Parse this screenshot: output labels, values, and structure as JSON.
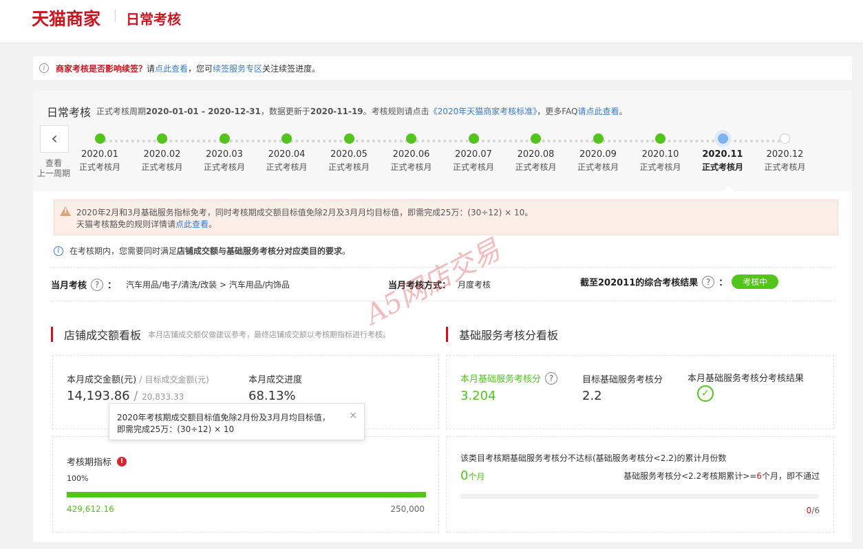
{
  "header": {
    "brand": "天猫商家",
    "title": "日常考核"
  },
  "notice": {
    "q": "商家考核是否影响续签？",
    "t1": "请",
    "link1": "点此查看",
    "t2": "，您可",
    "link2": "续签服务专区",
    "t3": "关注续签进度。"
  },
  "period": {
    "title": "日常考核",
    "d1": "正式考核周期",
    "range": "2020-01-01 - 2020-12-31",
    "d2": "，数据更新于",
    "updated": "2020-11-19",
    "d3": "。考核规则请点击",
    "rules_link": "《2020年天猫商家考核标准》",
    "d4": "，更多FAQ",
    "faq_link": "请点此查看",
    "d5": "。"
  },
  "prev": {
    "arrow": "‹",
    "line1": "查看",
    "line2": "上一周期"
  },
  "timeline": [
    {
      "date": "2020.01",
      "label": "正式考核月",
      "status": "done"
    },
    {
      "date": "2020.02",
      "label": "正式考核月",
      "status": "done"
    },
    {
      "date": "2020.03",
      "label": "正式考核月",
      "status": "done"
    },
    {
      "date": "2020.04",
      "label": "正式考核月",
      "status": "done"
    },
    {
      "date": "2020.05",
      "label": "正式考核月",
      "status": "done"
    },
    {
      "date": "2020.06",
      "label": "正式考核月",
      "status": "done"
    },
    {
      "date": "2020.07",
      "label": "正式考核月",
      "status": "done"
    },
    {
      "date": "2020.08",
      "label": "正式考核月",
      "status": "done"
    },
    {
      "date": "2020.09",
      "label": "正式考核月",
      "status": "done"
    },
    {
      "date": "2020.10",
      "label": "正式考核月",
      "status": "done"
    },
    {
      "date": "2020.11",
      "label": "正式考核月",
      "status": "current"
    },
    {
      "date": "2020.12",
      "label": "正式考核月",
      "status": "future"
    }
  ],
  "warning": {
    "line1": "2020年2月和3月基础服务指标免考，同时考核期成交额目标值免除2月及3月月均目标值，即需完成25万：(30÷12) × 10。",
    "line2_pre": "天猫考核豁免的规则详情请",
    "line2_link": "点此查看",
    "line2_post": "。"
  },
  "requirement": {
    "pre": "在考核期内，您需要同时满足",
    "bold": "店铺成交额与基础服务考核分对应类目的要求",
    "post": "。"
  },
  "summary": {
    "month_label": "当月考核",
    "colon": "：",
    "category": "汽车用品/电子/清洗/改装 > 汽车用品/内饰品",
    "method_label": "当月考核方式：",
    "method": "月度考核",
    "result_label": "截至202011的综合考核结果",
    "status": "考核中"
  },
  "watermark": "A5网店交易",
  "sales": {
    "title": "店铺成交额看板",
    "subtitle": "本月店铺成交额仅做建议参考，最终店铺成交额以考核期指标进行考核。",
    "amount_label": "本月成交金额(元)",
    "slash": "/",
    "target_label": "目标成交金额(元)",
    "amount": "14,193.86",
    "target": "20,833.33",
    "progress_label": "本月成交进度",
    "progress": "68.13%",
    "period_label": "考核期指标",
    "period_pct": "100%",
    "period_pct_value": 1.0,
    "period_value": "429,612.16",
    "period_target": "250,000"
  },
  "tooltip": {
    "line1": "2020年考核期成交额目标值免除2月份及3月月均目标值，",
    "line2": "即需完成25万：(30÷12) × 10",
    "close": "×"
  },
  "service": {
    "title": "基础服务考核分看板",
    "score_label": "本月基础服务考核分",
    "score": "3.204",
    "target_label": "目标基础服务考核分",
    "target": "2.2",
    "result_label": "本月基础服务考核分考核结果",
    "fail_title": "该类目考核期基础服务考核分不达标(基础服务考核分<2.2)的累计月份数",
    "fail_count": "0",
    "fail_unit": "个月",
    "rule_pre": "基础服务考核分<2.2考核期累计>=",
    "rule_num": "6",
    "rule_post": "个月，即不通过",
    "ratio_num": "0",
    "ratio_den": "/6"
  },
  "colors": {
    "brand_red": "#c9151e",
    "success_green": "#52c41a",
    "link_blue": "#3a7cc7"
  }
}
